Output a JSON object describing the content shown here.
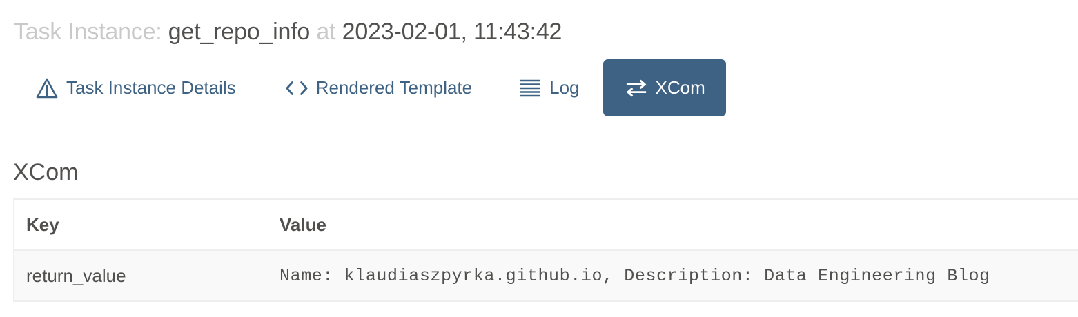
{
  "header": {
    "prefix": "Task Instance:",
    "task_id": "get_repo_info",
    "at_word": "at",
    "execution_date": "2023-02-01, 11:43:42"
  },
  "tabs": [
    {
      "label": "Task Instance Details",
      "icon": "warning-triangle-icon",
      "active": false
    },
    {
      "label": "Rendered Template",
      "icon": "code-brackets-icon",
      "active": false
    },
    {
      "label": "Log",
      "icon": "list-lines-icon",
      "active": false
    },
    {
      "label": "XCom",
      "icon": "swap-arrows-icon",
      "active": true
    }
  ],
  "section": {
    "title": "XCom"
  },
  "table": {
    "columns": [
      "Key",
      "Value"
    ],
    "rows": [
      {
        "key": "return_value",
        "value": "Name: klaudiaszpyrka.github.io, Description: Data Engineering Blog"
      }
    ]
  },
  "colors": {
    "accent": "#3e6283",
    "text": "#51504f",
    "muted": "#c9c9c9",
    "row_bg": "#f9f9f9"
  }
}
